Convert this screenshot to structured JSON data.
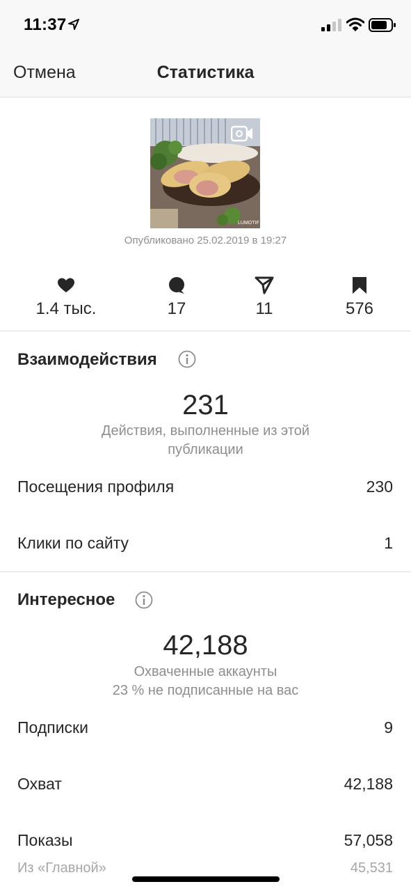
{
  "status_bar": {
    "time": "11:37"
  },
  "nav": {
    "cancel_label": "Отмена",
    "title": "Статистика"
  },
  "post": {
    "thumbnail_watermark": "LUMOTIF",
    "published": "Опубликовано 25.02.2019 в 19:27"
  },
  "metrics": [
    {
      "icon": "heart-icon",
      "value": "1.4 тыс."
    },
    {
      "icon": "comment-icon",
      "value": "17"
    },
    {
      "icon": "share-icon",
      "value": "11"
    },
    {
      "icon": "bookmark-icon",
      "value": "576"
    }
  ],
  "interactions": {
    "title": "Взаимодействия",
    "total": "231",
    "description": "Действия, выполненные из этой публикации",
    "rows": [
      {
        "label": "Посещения профиля",
        "value": "230"
      },
      {
        "label": "Клики по сайту",
        "value": "1"
      }
    ]
  },
  "discovery": {
    "title": "Интересное",
    "total": "42,188",
    "description_line1": "Охваченные аккаунты",
    "description_line2": "23 % не подписанные на вас",
    "rows": [
      {
        "label": "Подписки",
        "value": "9"
      },
      {
        "label": "Охват",
        "value": "42,188"
      },
      {
        "label": "Показы",
        "value": "57,058"
      }
    ],
    "sub_rows": [
      {
        "label": "Из «Главной»",
        "value": "45,531"
      }
    ]
  },
  "colors": {
    "text": "#262626",
    "secondary": "#8e8e8e",
    "divider": "#dbdbdb",
    "bar": "#f8f8f8"
  }
}
